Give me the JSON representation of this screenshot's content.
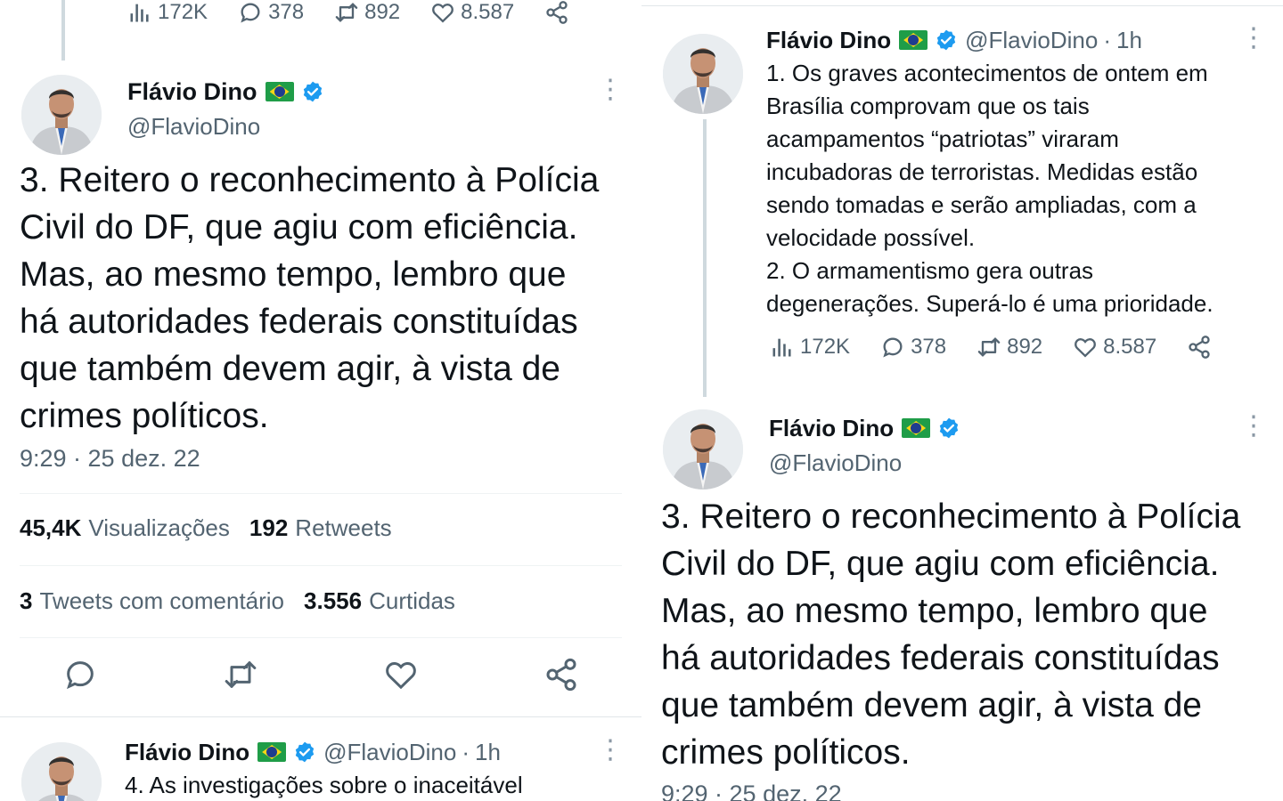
{
  "colors": {
    "text": "#0f1419",
    "muted": "#536471",
    "verified": "#1d9bf0",
    "divider": "#eff3f4"
  },
  "icons": [
    "views-icon",
    "reply-icon",
    "retweet-icon",
    "like-icon",
    "share-icon",
    "verified-badge-icon",
    "brazil-flag-icon",
    "more-icon"
  ],
  "left": {
    "prev_metrics": {
      "views": "172K",
      "replies": "378",
      "retweets": "892",
      "likes": "8.587"
    },
    "main_tweet": {
      "name": "Flávio Dino",
      "handle": "@FlavioDino",
      "lines": [
        "3. Reitero o reconhecimento à Polícia",
        "Civil do DF, que agiu com eficiência.",
        "Mas, ao mesmo tempo, lembro que",
        "há autoridades federais constituídas",
        "que também devem agir, à vista de",
        "crimes políticos."
      ],
      "timestamp": "9:29 · 25 dez. 22",
      "views_count": "45,4K",
      "views_label": "Visualizações",
      "retweets_count": "192",
      "retweets_label": "Retweets",
      "quotes_count": "3",
      "quotes_label": "Tweets com comentário",
      "likes_count": "3.556",
      "likes_label": "Curtidas"
    },
    "next_tweet": {
      "name": "Flávio Dino",
      "handle": "@FlavioDino",
      "time": "1h",
      "text": "4. As investigações sobre o inaceitável"
    }
  },
  "right": {
    "tweet1": {
      "name": "Flávio Dino",
      "handle": "@FlavioDino",
      "time": "1h",
      "lines": [
        "1. Os graves acontecimentos de ontem em",
        "Brasília comprovam que os tais",
        "acampamentos “patriotas” viraram",
        "incubadoras de terroristas. Medidas estão",
        "sendo tomadas e serão ampliadas, com a",
        "velocidade possível.",
        "2. O armamentismo gera outras",
        "degenerações. Superá-lo é uma prioridade."
      ],
      "metrics": {
        "views": "172K",
        "replies": "378",
        "retweets": "892",
        "likes": "8.587"
      }
    },
    "tweet2": {
      "name": "Flávio Dino",
      "handle": "@FlavioDino",
      "lines": [
        "3. Reitero o reconhecimento à Polícia",
        "Civil do DF, que agiu com eficiência.",
        "Mas, ao mesmo tempo, lembro que",
        "há autoridades federais constituídas",
        "que também devem agir, à vista de",
        "crimes políticos."
      ],
      "timestamp": "9:29 · 25 dez. 22"
    }
  }
}
